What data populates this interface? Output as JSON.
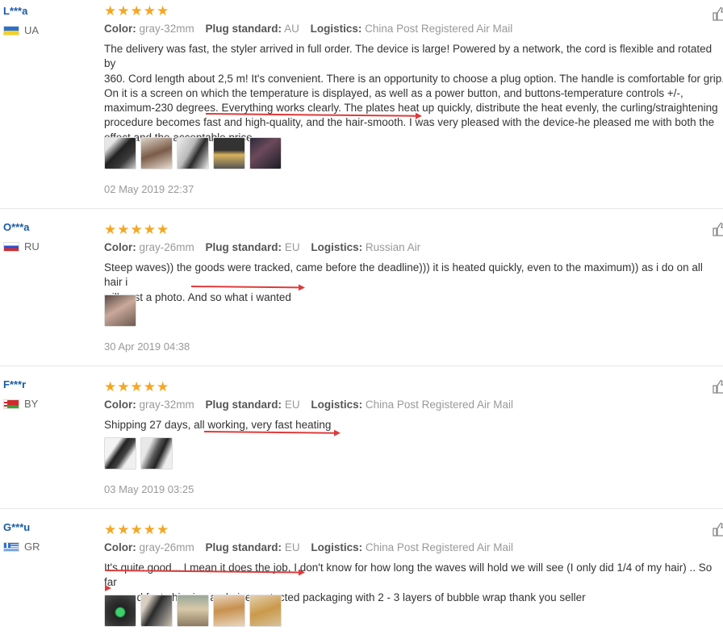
{
  "reviews": [
    {
      "user": "L***a",
      "country": "UA",
      "rating": "★★★★★",
      "color_label": "Color:",
      "color": "gray-32mm",
      "plug_label": "Plug standard:",
      "plug": "AU",
      "logistics_label": "Logistics:",
      "logistics": "China Post Registered Air Mail",
      "text": "The delivery was fast, the styler arrived in full order. The device is large! Powered by a network, the cord is flexible and rotated by\n360. Cord length about 2,5 m! It's convenient. There is an opportunity to choose a plug option. The handle is comfortable for grip.\nOn it is a screen on which the temperature is displayed, as well as a power button, and buttons-temperature controls +/-,\nmaximum-230 degrees. Everything works clearly. The plates heat up quickly, distribute the heat evenly, the curling/straightening\nprocedure becomes fast and high-quality, and the hair-smooth. I was very pleased with the device-he pleased me with both the\neffect and the acceptable price.",
      "date": "02 May 2019 22:37",
      "photo_count": 5
    },
    {
      "user": "O***a",
      "country": "RU",
      "rating": "★★★★★",
      "color_label": "Color:",
      "color": "gray-26mm",
      "plug_label": "Plug standard:",
      "plug": "EU",
      "logistics_label": "Logistics:",
      "logistics": "Russian Air",
      "text": "Steep waves)) the goods were tracked, came before the deadline))) it is heated quickly, even to the maximum)) as i do on all hair i\nwill post a photo. And so what i wanted",
      "date": "30 Apr 2019 04:38",
      "photo_count": 1
    },
    {
      "user": "F***r",
      "country": "BY",
      "rating": "★★★★★",
      "color_label": "Color:",
      "color": "gray-32mm",
      "plug_label": "Plug standard:",
      "plug": "EU",
      "logistics_label": "Logistics:",
      "logistics": "China Post Registered Air Mail",
      "text": "Shipping 27 days, all working, very fast heating",
      "date": "03 May 2019 03:25",
      "photo_count": 2
    },
    {
      "user": "G***u",
      "country": "GR",
      "rating": "★★★★★",
      "color_label": "Color:",
      "color": "gray-26mm",
      "plug_label": "Plug standard:",
      "plug": "EU",
      "logistics_label": "Logistics:",
      "logistics": "China Post Registered Air Mail",
      "text": "It's quite good... I mean it does the job, I don't know for how long the waves will hold we will see (I only did 1/4 of my hair) .. So far\nso good fast shipping and nice protected packaging with 2 - 3 layers of bubble wrap thank you seller",
      "photo_count": 5
    }
  ],
  "icons": {
    "helpful": "thumbs-up-icon",
    "photo": "review-photo"
  },
  "colors": {
    "star": "#f5a623",
    "user": "#1a5aa8",
    "annotation": "#e03a3a"
  }
}
